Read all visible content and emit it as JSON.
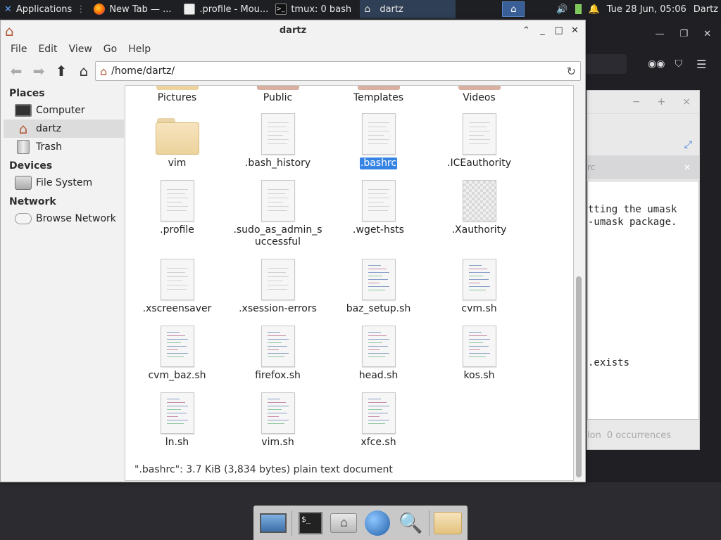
{
  "panel": {
    "applications_label": "Applications",
    "tasks": [
      {
        "label": "New Tab — ...",
        "icon": "firefox-icon"
      },
      {
        "label": ".profile - Mou...",
        "icon": "editor-icon"
      },
      {
        "label": "tmux: 0 bash",
        "icon": "terminal-icon"
      },
      {
        "label": "dartz",
        "icon": "home-folder-icon"
      }
    ],
    "clock": "Tue 28 Jun, 05:06",
    "user": "Dartz"
  },
  "window": {
    "title": "dartz",
    "menu": [
      "File",
      "Edit",
      "View",
      "Go",
      "Help"
    ],
    "location": "/home/dartz/"
  },
  "sidebar": {
    "places_heading": "Places",
    "places": [
      {
        "label": "Computer",
        "icon": "computer-icon",
        "selected": false
      },
      {
        "label": "dartz",
        "icon": "home-icon",
        "selected": true
      },
      {
        "label": "Trash",
        "icon": "trash-icon",
        "selected": false
      }
    ],
    "devices_heading": "Devices",
    "devices": [
      {
        "label": "File System",
        "icon": "drive-icon"
      }
    ],
    "network_heading": "Network",
    "network": [
      {
        "label": "Browse Network",
        "icon": "network-icon"
      }
    ]
  },
  "files": {
    "top_row": [
      "Pictures",
      "Public",
      "Templates",
      "Videos"
    ],
    "grid": [
      [
        "vim",
        ".bash_history",
        ".bashrc",
        ".ICEauthority"
      ],
      [
        ".profile",
        ".sudo_as_admin_successful",
        ".wget-hsts",
        ".Xauthority"
      ],
      [
        ".xscreensaver",
        ".xsession-errors",
        "baz_setup.sh",
        "cvm.sh"
      ],
      [
        "cvm_baz.sh",
        "firefox.sh",
        "head.sh",
        "kos.sh"
      ],
      [
        "ln.sh",
        "vim.sh",
        "xfce.sh"
      ]
    ],
    "selected": ".bashrc"
  },
  "status": "\".bashrc\": 3.7 KiB (3,834 bytes) plain text document",
  "background_editor": {
    "tab_fragment": "rc",
    "lines": [
      "tting the umask",
      "-umask package.",
      ".exists"
    ],
    "status_fragment": "lon",
    "occurrences": "0 occurrences"
  },
  "colors": {
    "accent": "#3584e4",
    "panel": "#1e1f22"
  }
}
